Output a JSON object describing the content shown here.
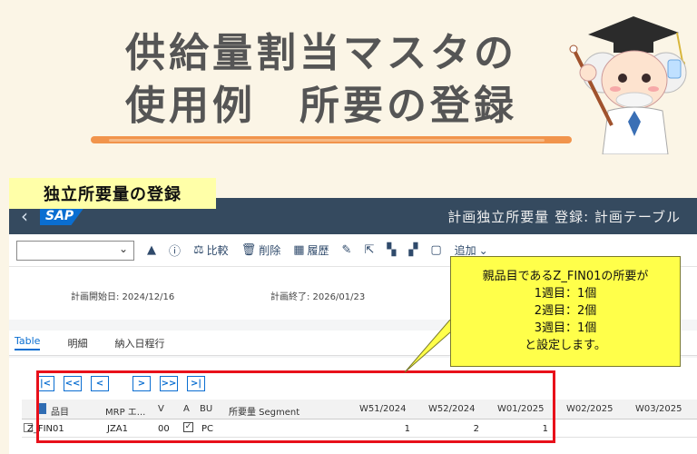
{
  "header": {
    "title_line1": "供給量割当マスタの",
    "title_line2": "使用例　所要の登録"
  },
  "section_label": "独立所要量の登録",
  "sap": {
    "logo": "SAP",
    "app_title": "計画独立所要量 登録: 計画テーブル",
    "toolbar": {
      "compare": "比較",
      "delete": "削除",
      "history": "履歴",
      "add": "追加"
    },
    "dates": {
      "plan_start": "計画開始日: 2024/12/16",
      "plan_end": "計画終了: 2026/01/23"
    },
    "tabs": [
      "Table",
      "明細",
      "納入日程行"
    ],
    "nav_buttons": [
      "|<",
      "<<",
      "<",
      ">",
      ">>",
      ">|"
    ],
    "columns": [
      "品目",
      "MRP エ...",
      "V",
      "A",
      "BU",
      "所要量 Segment",
      "W51/2024",
      "W52/2024",
      "W01/2025",
      "W02/2025",
      "W03/2025"
    ],
    "rows": [
      {
        "item": "Z_FIN01",
        "mrp": "JZA1",
        "v": "00",
        "bu": "PC",
        "w51": "1",
        "w52": "2",
        "w01": "1"
      }
    ]
  },
  "callout": {
    "line1": "親品目であるZ_FIN01の所要が",
    "line2": "1週目：1個",
    "line3": "2週目：2個",
    "line4": "3週目：1個",
    "line5": "と設定します。"
  },
  "colors": {
    "shell": "#354a5f",
    "highlight": "#e8101a",
    "callout": "#ffff4a",
    "brush": "#f08a3c"
  }
}
